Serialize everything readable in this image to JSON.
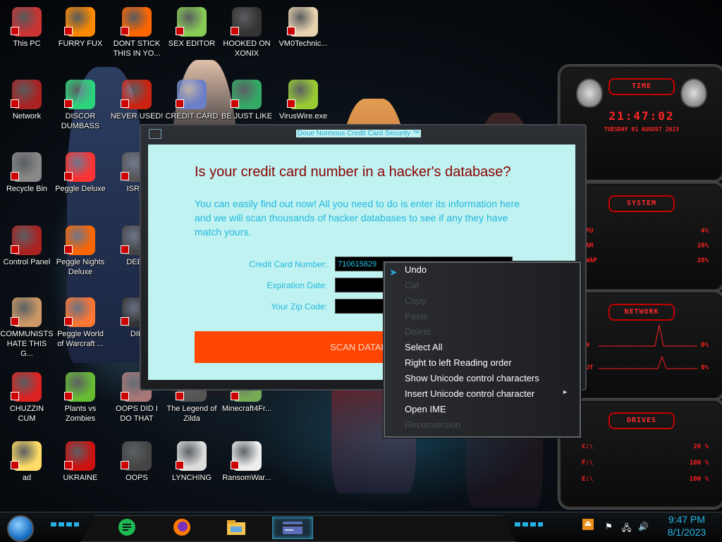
{
  "desktop_icons": [
    {
      "label": "This PC",
      "icon": "computer-icon"
    },
    {
      "label": "FURRY FUX",
      "icon": "firefox-icon"
    },
    {
      "label": "DONT STICK THIS IN YO...",
      "icon": "vlc-cone-icon"
    },
    {
      "label": "SEX EDITOR",
      "icon": "hxd-editor-icon"
    },
    {
      "label": "HOOKED ON XONIX",
      "icon": "xonix-game-icon"
    },
    {
      "label": "VM0Technic...",
      "icon": "doctor-person-icon"
    },
    {
      "label": "Network",
      "icon": "network-globe-icon"
    },
    {
      "label": "DISCOR DUMBASS",
      "icon": "chat-app-icon"
    },
    {
      "label": "NEVER USED!",
      "icon": "dev-badge-icon"
    },
    {
      "label": "CREDIT CARD",
      "icon": "credit-card-icon"
    },
    {
      "label": "BE JUST LIKE",
      "icon": "santa-elf-icon"
    },
    {
      "label": "VirusWire.exe",
      "icon": "lime-icon"
    },
    {
      "label": "Recycle Bin",
      "icon": "recycle-bin-icon"
    },
    {
      "label": "Peggle Deluxe",
      "icon": "peggle-icon"
    },
    {
      "label": "ISRAI",
      "icon": "robot-icon"
    },
    {
      "label": "Control Panel",
      "icon": "control-panel-icon"
    },
    {
      "label": "Peggle Nights Deluxe",
      "icon": "peggle-nights-icon"
    },
    {
      "label": "DEEZ",
      "icon": "robot-icon"
    },
    {
      "label": "COMMUNISTS HATE THIS G...",
      "icon": "money-bag-icon"
    },
    {
      "label": "Peggle World of Warcraft ...",
      "icon": "peggle-wow-icon"
    },
    {
      "label": "DIE",
      "icon": "folder-icon"
    },
    {
      "label": "CHUZZIN CUM",
      "icon": "chuzzle-icon"
    },
    {
      "label": "Plants vs Zombies",
      "icon": "pvz-icon"
    },
    {
      "label": "OOPS DID I DO THAT",
      "icon": "person-photo-icon"
    },
    {
      "label": "The Legend of Zilda",
      "icon": "zelda-icon"
    },
    {
      "label": "Minecraft4Fr...",
      "icon": "minecraft-icon"
    },
    {
      "label": "ad",
      "icon": "cartoon-girl-icon"
    },
    {
      "label": "UKRAINE",
      "icon": "radiation-icon"
    },
    {
      "label": "OOPS",
      "icon": "monitor-icon"
    },
    {
      "label": "LYNCHING",
      "icon": "rope-noose-icon"
    },
    {
      "label": "RansomWar...",
      "icon": "skull-icon"
    }
  ],
  "window": {
    "title": "Doue Normous Credit Card Security ™",
    "heading": "Is your credit card number in a hacker's database?",
    "description": "You can easily find out now! All you need to do is enter its information here and we will scan thousands of hacker databases to see if any they have match yours.",
    "fields": [
      {
        "label": "Credit Card Number:",
        "value": "710615829"
      },
      {
        "label": "Expiration Date:",
        "value": ""
      },
      {
        "label": "Your Zip Code:",
        "value": ""
      }
    ],
    "scan_label": "SCAN DATABASES"
  },
  "context_menu": {
    "items": [
      {
        "label": "Undo",
        "enabled": true
      },
      {
        "label": "Cut",
        "enabled": false
      },
      {
        "label": "Copy",
        "enabled": false
      },
      {
        "label": "Paste",
        "enabled": false
      },
      {
        "label": "Delete",
        "enabled": false
      },
      {
        "label": "Select All",
        "enabled": true
      },
      {
        "label": "Right to left Reading order",
        "enabled": true
      },
      {
        "label": "Show Unicode control characters",
        "enabled": true
      },
      {
        "label": "Insert Unicode control character",
        "enabled": true,
        "submenu": true
      },
      {
        "label": "Open IME",
        "enabled": true
      },
      {
        "label": "Reconversion",
        "enabled": false
      }
    ],
    "submenu_arrow": "►"
  },
  "gadgets": {
    "time": {
      "head": "TIME",
      "clock": "21:47:02",
      "date": "TUESDAY 01 AUGUST 2023"
    },
    "system": {
      "head": "SYSTEM",
      "rows": [
        {
          "k": "CPU",
          "v": "4%"
        },
        {
          "k": "RAM",
          "v": "28%"
        },
        {
          "k": "SWAP",
          "v": "28%"
        }
      ]
    },
    "network": {
      "head": "NETWORK",
      "rows": [
        {
          "k": "IN",
          "v": "0%"
        },
        {
          "k": "OUT",
          "v": "0%"
        }
      ]
    },
    "drives": {
      "head": "DRIVES",
      "rows": [
        {
          "k": "C:\\",
          "v": "26 %"
        },
        {
          "k": "F:\\",
          "v": "100 %"
        },
        {
          "k": "E:\\",
          "v": "100 %"
        }
      ]
    }
  },
  "taskbar": {
    "time": "9:47 PM",
    "date": "8/1/2023",
    "pins": [
      "chat-app-icon",
      "firefox-icon",
      "file-explorer-icon",
      "credit-card-icon"
    ],
    "tray_icons": [
      "eject-icon",
      "flag-icon",
      "network-icon",
      "volume-icon"
    ]
  }
}
